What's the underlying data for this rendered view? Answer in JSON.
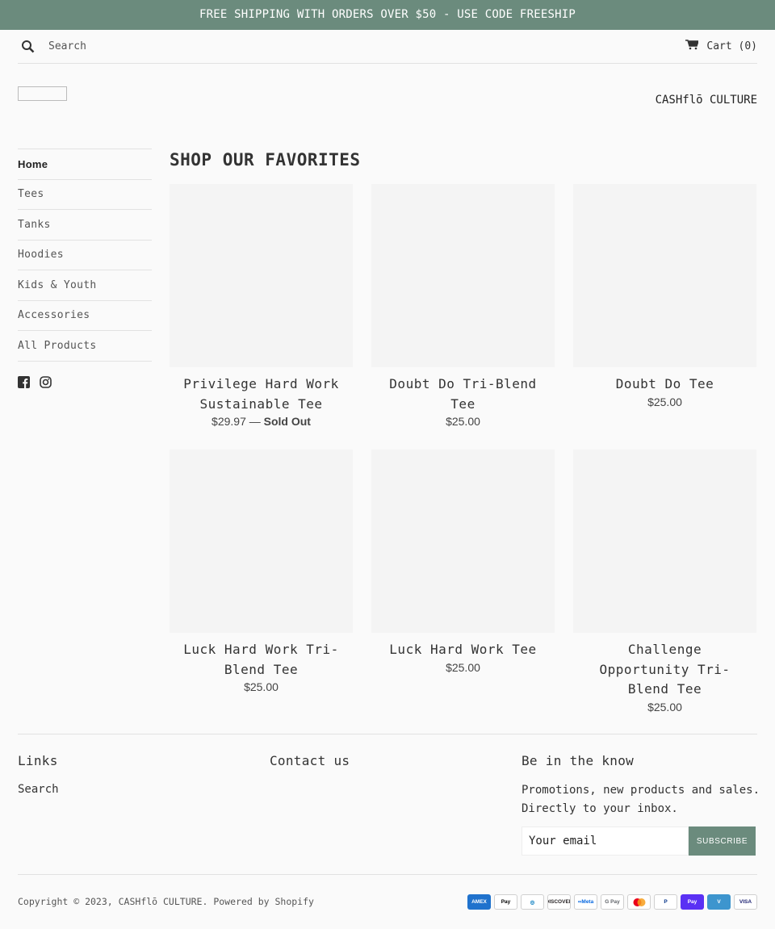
{
  "announcement": "FREE SHIPPING WITH ORDERS OVER $50 - USE CODE FREESHIP",
  "header": {
    "search_placeholder": "Search",
    "cart_label": "Cart (0)",
    "brand": "CASHflō CULTURE"
  },
  "sidebar": {
    "items": [
      {
        "label": "Home",
        "active": true
      },
      {
        "label": "Tees"
      },
      {
        "label": "Tanks"
      },
      {
        "label": "Hoodies"
      },
      {
        "label": "Kids & Youth"
      },
      {
        "label": "Accessories"
      },
      {
        "label": "All Products"
      }
    ],
    "social": [
      "facebook-icon",
      "instagram-icon"
    ]
  },
  "main": {
    "heading": "SHOP OUR FAVORITES",
    "products": [
      {
        "title": "Privilege Hard Work Sustainable Tee",
        "price": "$29.97",
        "sold_out": "Sold Out"
      },
      {
        "title": "Doubt Do Tri-Blend Tee",
        "price": "$25.00"
      },
      {
        "title": "Doubt Do Tee",
        "price": "$25.00"
      },
      {
        "title": "Luck Hard Work Tri-Blend Tee",
        "price": "$25.00"
      },
      {
        "title": "Luck Hard Work Tee",
        "price": "$25.00"
      },
      {
        "title": "Challenge Opportunity Tri-Blend Tee",
        "price": "$25.00"
      }
    ]
  },
  "footer": {
    "links_heading": "Links",
    "links": [
      "Search"
    ],
    "contact_heading": "Contact us",
    "newsletter_heading": "Be in the know",
    "newsletter_text": "Promotions, new products and sales. Directly to your inbox.",
    "email_placeholder": "Your email",
    "subscribe_label": "SUBSCRIBE",
    "copyright": "Copyright © 2023, CASHflō CULTURE. Powered by Shopify",
    "payments": [
      {
        "name": "amex-icon",
        "label": "AMEX",
        "bg": "#1f72cd",
        "fg": "#ffffff"
      },
      {
        "name": "apple-pay-icon",
        "label": "Pay",
        "bg": "#ffffff",
        "fg": "#000000"
      },
      {
        "name": "diners-club-icon",
        "label": "◎",
        "bg": "#ffffff",
        "fg": "#0079be"
      },
      {
        "name": "discover-icon",
        "label": "DISCOVER",
        "bg": "#ffffff",
        "fg": "#231f20"
      },
      {
        "name": "meta-pay-icon",
        "label": "∞Meta",
        "bg": "#ffffff",
        "fg": "#0668e1"
      },
      {
        "name": "google-pay-icon",
        "label": "G Pay",
        "bg": "#ffffff",
        "fg": "#5f6368"
      },
      {
        "name": "mastercard-icon",
        "label": "",
        "bg": "#ffffff",
        "fg": "#eb001b"
      },
      {
        "name": "paypal-icon",
        "label": "P",
        "bg": "#ffffff",
        "fg": "#003087"
      },
      {
        "name": "shop-pay-icon",
        "label": "Pay",
        "bg": "#5a31f4",
        "fg": "#ffffff"
      },
      {
        "name": "venmo-icon",
        "label": "V",
        "bg": "#3d95ce",
        "fg": "#ffffff"
      },
      {
        "name": "visa-icon",
        "label": "VISA",
        "bg": "#ffffff",
        "fg": "#1a1f71"
      }
    ]
  },
  "colors": {
    "accent": "#6b8b7d",
    "background": "#fafafa",
    "image_placeholder": "#f4f4f4"
  }
}
